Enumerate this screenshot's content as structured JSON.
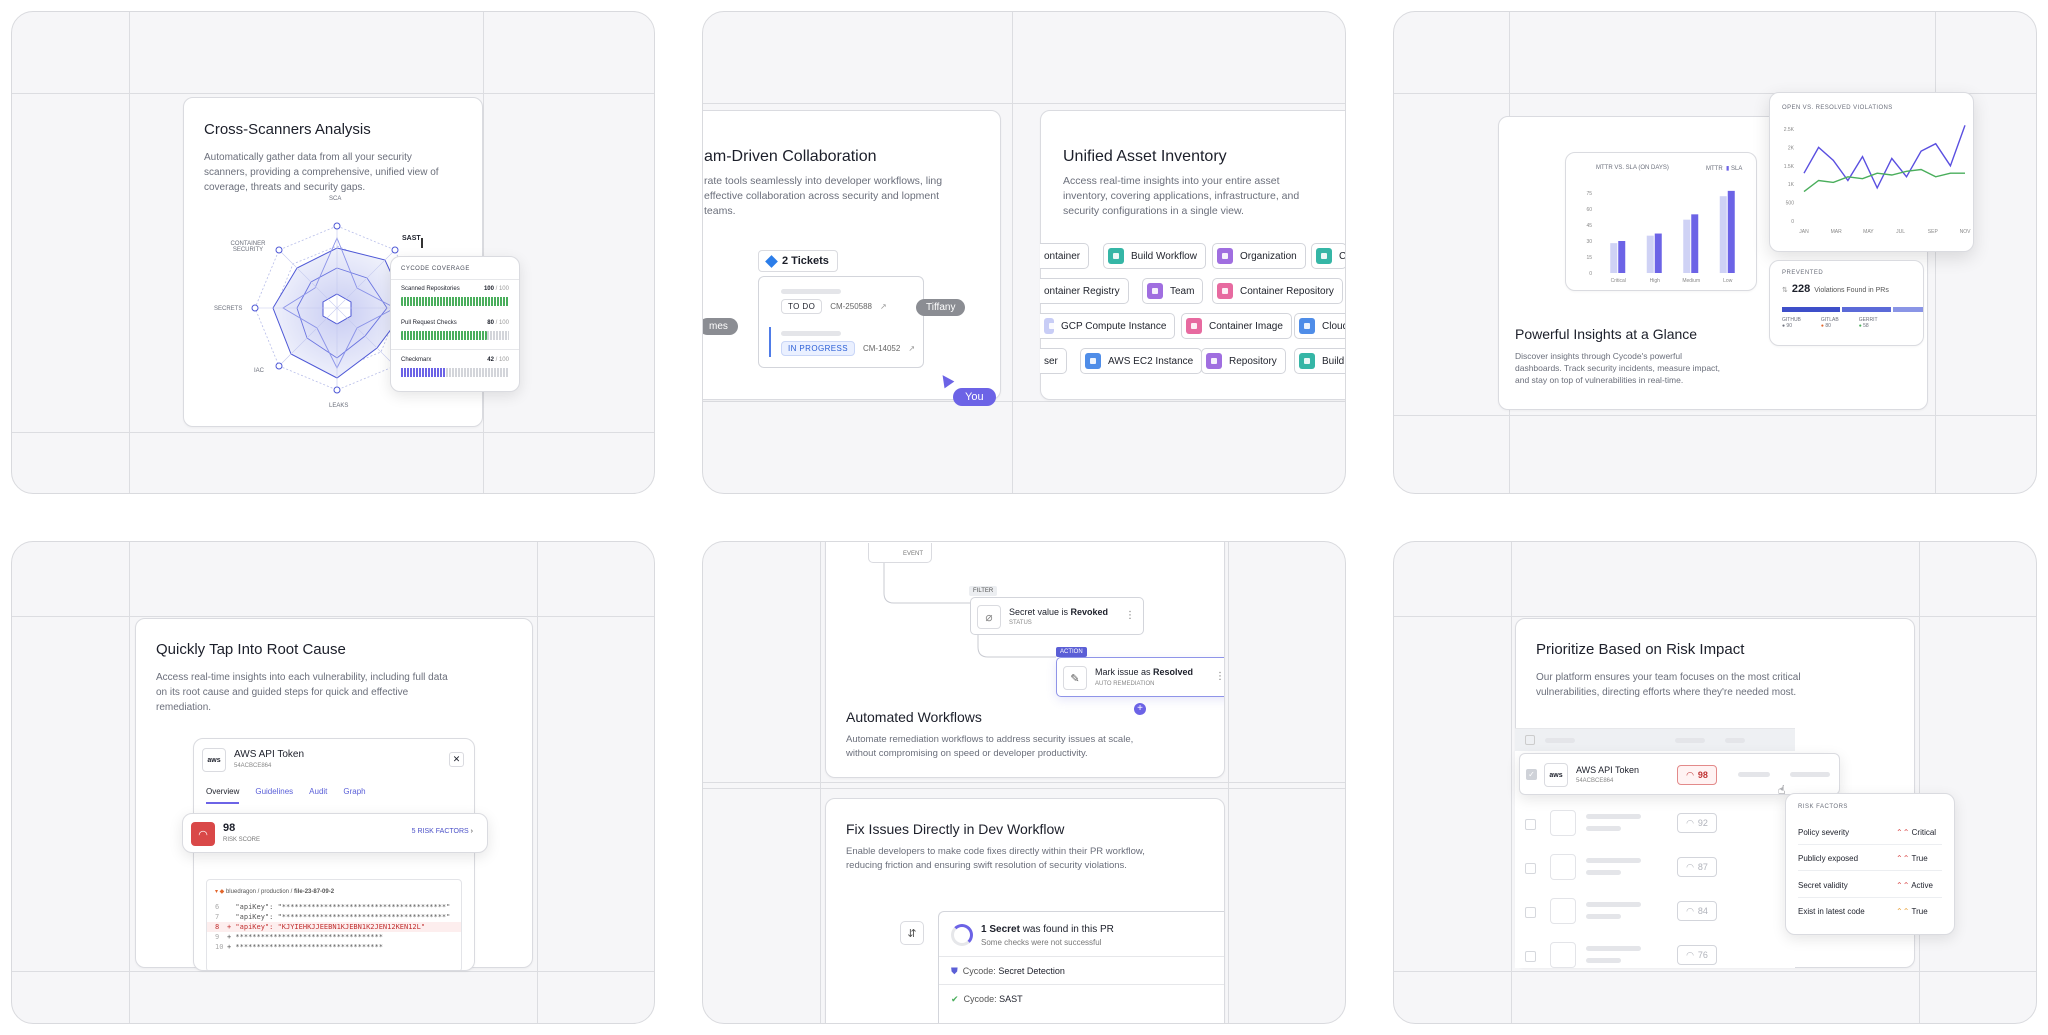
{
  "t1": {
    "title": "Cross-Scanners Analysis",
    "desc": "Automatically gather data from all your security scanners, providing a comprehensive, unified view of coverage, threats and security gaps.",
    "radar": [
      "SCA",
      "SAST",
      "",
      "",
      "LEAKS",
      "IAC",
      "SECRETS",
      "CONTAINER SECURITY"
    ],
    "cov": {
      "title": "CYCODE COVERAGE",
      "rows": [
        {
          "label": "Scanned Repositories",
          "val": "100",
          "tot": "/ 100"
        },
        {
          "label": "Pull Request Checks",
          "val": "80",
          "tot": "/ 100"
        },
        {
          "label": "Checkmarx",
          "val": "42",
          "tot": "/ 100"
        }
      ]
    }
  },
  "t2": {
    "title": "Team-Driven Collaboration",
    "title_visible": "am-Driven Collaboration",
    "desc": "rate tools seamlessly into developer workflows, ling effective collaboration across security and lopment teams.",
    "tickets": "2 Tickets",
    "r1": {
      "status": "TO DO",
      "id": "CM-250588"
    },
    "r2": {
      "status": "IN PROGRESS",
      "id": "CM-14052"
    },
    "tiffany": "Tiffany",
    "you": "You",
    "left": "mes"
  },
  "t3": {
    "title": "Unified Asset Inventory",
    "desc": "Access real-time insights into your entire asset inventory, covering applications, infrastructure, and security configurations in a single view.",
    "pills": [
      [
        "ontainer",
        "Build Workflow",
        "Organization",
        "C"
      ],
      [
        "ontainer Registry",
        "Team",
        "Container Repository"
      ],
      [
        "GCP Compute Instance",
        "Container Image",
        "Cloud"
      ],
      [
        "ser",
        "AWS EC2 Instance",
        "Repository",
        "Build"
      ]
    ]
  },
  "t4": {
    "title": "Powerful Insights at a Glance",
    "desc": "Discover insights through Cycode's powerful dashboards. Track security incidents, measure impact, and stay on top of vulnerabilities in real-time.",
    "bar_title": "MTTR VS. SLA (ON DAYS)",
    "legend": [
      "MTTR",
      "SLA"
    ],
    "line_title": "OPEN VS. RESOLVED VIOLATIONS",
    "prevented": "PREVENTED",
    "prevented_n": "228",
    "prevented_txt": "Violations Found in PRs",
    "src": [
      {
        "n": "GITHUB",
        "v": "90"
      },
      {
        "n": "GITLAB",
        "v": "80"
      },
      {
        "n": "GERRIT",
        "v": "58"
      }
    ]
  },
  "t5": {
    "title": "Quickly Tap Into Root Cause",
    "desc": "Access real-time insights into each vulnerability, including full data on its root cause and guided steps for quick and effective remediation.",
    "card": "AWS API Token",
    "id": "54ACBCE864",
    "tabs": [
      "Overview",
      "Guidelines",
      "Audit",
      "Graph"
    ],
    "score": "98",
    "score_lbl": "RISK SCORE",
    "factors": "5 RISK FACTORS",
    "path1": "bluedragon / production /",
    "path2": "file-23-87-09-2",
    "code": [
      [
        "6",
        "  \"apiKey\": \"***************************************\""
      ],
      [
        "7",
        "  \"apiKey\": \"***************************************\""
      ],
      [
        "8",
        "+ \"apiKey\": \"KJYIEHKJJEEBN1KJEBN1K2JEN12KEN12L\""
      ],
      [
        "9",
        "+ ***********************************"
      ],
      [
        "10",
        "+ ***********************************"
      ]
    ]
  },
  "t6": {
    "event": "EVENT",
    "filter": "FILTER",
    "n1": {
      "a": "Secret value is ",
      "b": "Revoked",
      "s": "STATUS"
    },
    "action": "ACTION",
    "n2": {
      "a": "Mark issue as ",
      "b": "Resolved",
      "s": "AUTO REMEDIATION"
    },
    "title": "Automated Workflows",
    "desc": "Automate remediation workflows to address security issues at scale, without compromising on speed or developer productivity.",
    "title2": "Fix Issues Directly in Dev Workflow",
    "desc2": "Enable developers to make code fixes directly within their PR workflow, reducing friction and ensuring swift resolution of security violations.",
    "pr": {
      "a": "1 Secret",
      "b": " was found in this PR",
      "s": "Some checks were not successful"
    },
    "c1": {
      "a": "Cycode: ",
      "b": "Secret Detection"
    },
    "c2": {
      "a": "Cycode: ",
      "b": "SAST"
    }
  },
  "t7": {
    "title": "Prioritize Based on Risk Impact",
    "desc": "Our platform ensures your team focuses on the most critical vulnerabilities, directing efforts where they're needed most.",
    "row": {
      "name": "AWS API Token",
      "id": "54ACBCE864",
      "score": "98"
    },
    "scores": [
      "92",
      "87",
      "84",
      "76"
    ],
    "rf_title": "RISK FACTORS",
    "rf": [
      [
        "Policy severity",
        "Critical"
      ],
      [
        "Publicly exposed",
        "True"
      ],
      [
        "Secret validity",
        "Active"
      ],
      [
        "Exist in latest code",
        "True"
      ]
    ]
  },
  "chart_bar": {
    "type": "bar",
    "title": "MTTR VS. SLA (ON DAYS)",
    "categories": [
      "Critical",
      "High",
      "Medium",
      "Low"
    ],
    "series": [
      {
        "name": "MTTR",
        "values": [
          28,
          35,
          50,
          72
        ]
      },
      {
        "name": "SLA",
        "values": [
          30,
          37,
          55,
          77
        ]
      }
    ],
    "ylim": [
      0,
      75
    ],
    "yticks": [
      "0",
      "15",
      "30",
      "45",
      "60",
      "75"
    ]
  },
  "chart_line": {
    "type": "line",
    "title": "OPEN VS. RESOLVED VIOLATIONS",
    "categories": [
      "JAN",
      "MAR",
      "MAY",
      "JUL",
      "SEP",
      "NOV"
    ],
    "series": [
      {
        "name": "Open",
        "values": [
          1300,
          2000,
          1650,
          1100,
          1750,
          900,
          1700,
          1200,
          1900,
          2100,
          1500,
          2600
        ]
      },
      {
        "name": "Resolved",
        "values": [
          800,
          1100,
          1050,
          1200,
          1150,
          1300,
          1250,
          1350,
          1400,
          1200,
          1300,
          1300
        ]
      }
    ],
    "ylim": [
      0,
      2500
    ],
    "yticks": [
      "0",
      "500",
      "1K",
      "1.5K",
      "2K",
      "2.5K"
    ]
  }
}
